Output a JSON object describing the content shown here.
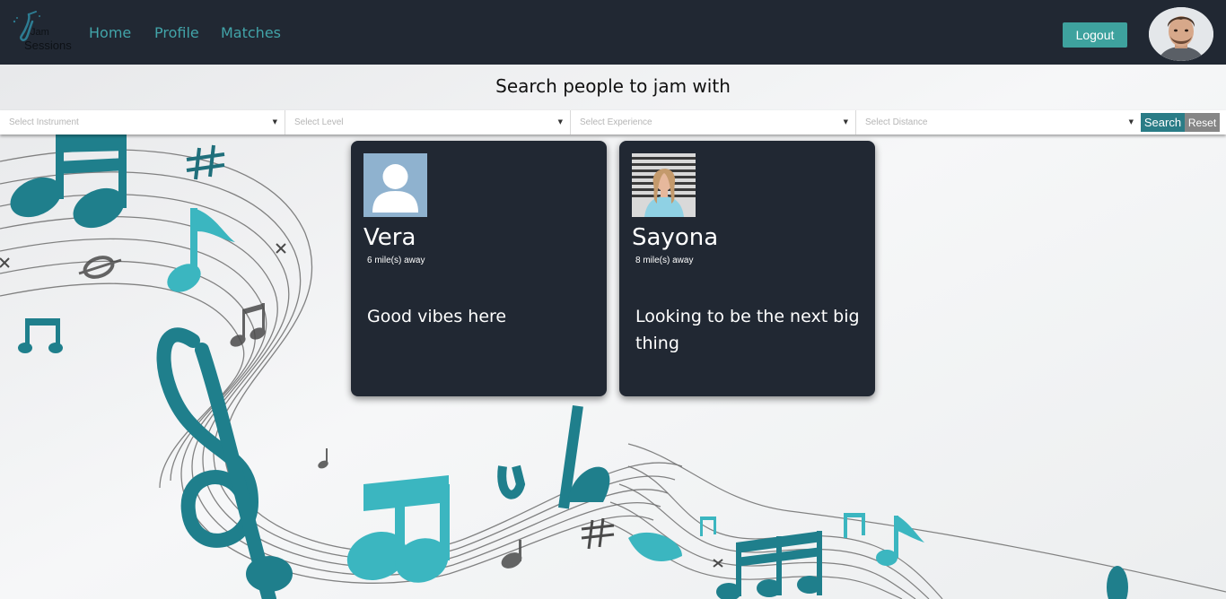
{
  "brand": {
    "logo_line1": "Jam",
    "logo_line2": "Sessions"
  },
  "nav": {
    "links": [
      {
        "label": "Home"
      },
      {
        "label": "Profile"
      },
      {
        "label": "Matches"
      }
    ],
    "logout_label": "Logout"
  },
  "search": {
    "title": "Search people to jam with",
    "filters": [
      {
        "placeholder": "Select Instrument"
      },
      {
        "placeholder": "Select Level"
      },
      {
        "placeholder": "Select Experience"
      },
      {
        "placeholder": "Select Distance"
      }
    ],
    "search_label": "Search",
    "reset_label": "Reset"
  },
  "results": [
    {
      "name": "Vera",
      "distance": "6 mile(s) away",
      "bio": "Good vibes here"
    },
    {
      "name": "Sayona",
      "distance": "8 mile(s) away",
      "bio": "Looking to be the next big thing"
    }
  ],
  "colors": {
    "navbar": "#212833",
    "accent": "#42a4a9",
    "logout": "#3ea29e",
    "search_button": "#2a7c86",
    "reset_button": "#868686",
    "card": "#212833",
    "note_teal": "#1f7f8c",
    "note_light": "#3bb6c0"
  }
}
